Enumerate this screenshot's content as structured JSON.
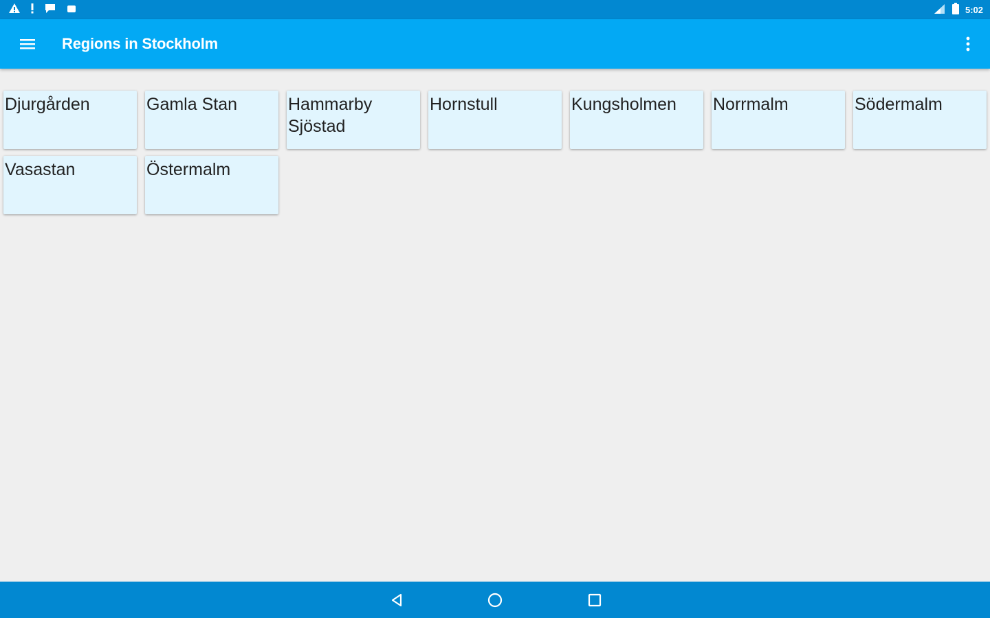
{
  "status_bar": {
    "time": "5:02",
    "left_icons": [
      "warning-icon",
      "alert-icon",
      "chat-icon",
      "android-icon"
    ],
    "right_icons": [
      "signal-icon",
      "battery-icon"
    ]
  },
  "app_bar": {
    "title": "Regions in Stockholm",
    "menu_icon": "hamburger-menu-icon",
    "overflow_icon": "more-vert-icon",
    "color": "#03a9f4"
  },
  "regions": [
    {
      "name": "Djurgården"
    },
    {
      "name": "Gamla Stan"
    },
    {
      "name": "Hammarby Sjöstad"
    },
    {
      "name": "Hornstull"
    },
    {
      "name": "Kungsholmen"
    },
    {
      "name": "Norrmalm"
    },
    {
      "name": "Södermalm"
    },
    {
      "name": "Vasastan"
    },
    {
      "name": "Östermalm"
    }
  ],
  "nav_bar": {
    "buttons": [
      "back-icon",
      "home-icon",
      "recents-icon"
    ],
    "color": "#0288d1"
  }
}
